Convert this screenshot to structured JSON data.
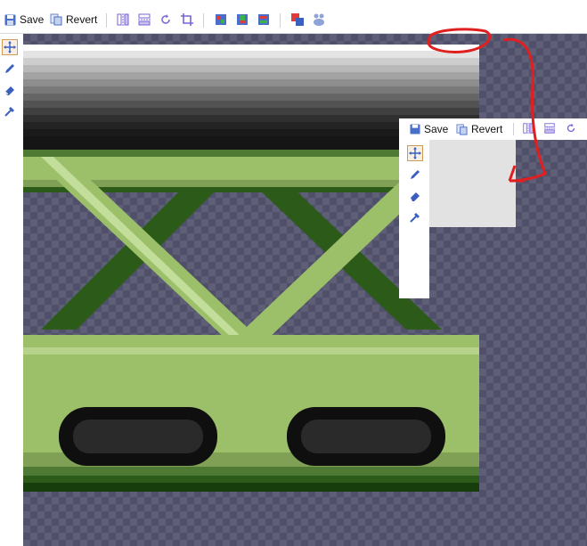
{
  "toolbar": {
    "save_label": "Save",
    "revert_label": "Revert",
    "icons": [
      "flip-horizontal-icon",
      "flip-vertical-icon",
      "rotate-icon",
      "crop-icon",
      "layer-add-icon",
      "layer-merge-icon",
      "layer-split-icon",
      "color-picker-icon",
      "palette-icon"
    ]
  },
  "sidebar": {
    "tools": [
      "move-icon",
      "pencil-icon",
      "eraser-icon",
      "dropper-icon"
    ],
    "active_tool": "move-icon"
  },
  "inset": {
    "save_label": "Save",
    "revert_label": "Revert"
  },
  "colors": {
    "accent": "#6c5bd6",
    "tool_blue": "#3b5fbf",
    "annotation_red": "#e02020",
    "girder_light": "#9cbf69",
    "girder_mid": "#7fa055",
    "girder_dark": "#2c5a19",
    "hole": "#151515"
  }
}
